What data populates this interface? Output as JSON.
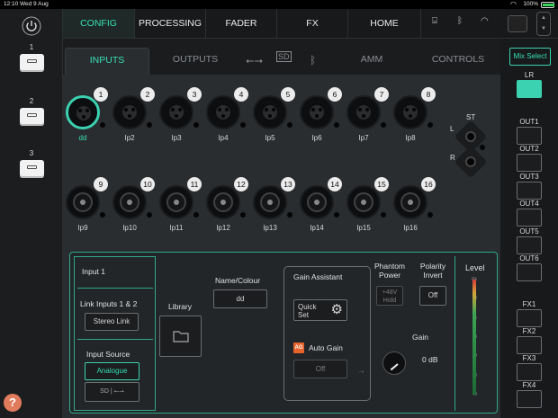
{
  "status": {
    "time": "12:10",
    "date": "Wed 9 Aug",
    "battery": "100%",
    "battery_level": 1.0
  },
  "scenes": [
    {
      "number": "1"
    },
    {
      "number": "2"
    },
    {
      "number": "3"
    }
  ],
  "help_label": "?",
  "top_tabs": [
    {
      "label": "CONFIG",
      "active": true
    },
    {
      "label": "PROCESSING",
      "active": false
    },
    {
      "label": "FADER",
      "active": false
    },
    {
      "label": "FX",
      "active": false
    },
    {
      "label": "HOME",
      "active": false
    }
  ],
  "sub_tabs": [
    {
      "label": "INPUTS",
      "active": true
    },
    {
      "label": "OUTPUTS",
      "active": false
    },
    {
      "label": "AMM",
      "active": false
    },
    {
      "label": "CONTROLS",
      "active": false
    }
  ],
  "inputs_row1": [
    {
      "num": "1",
      "label": "dd",
      "selected": true
    },
    {
      "num": "2",
      "label": "Ip2"
    },
    {
      "num": "3",
      "label": "Ip3"
    },
    {
      "num": "4",
      "label": "Ip4"
    },
    {
      "num": "5",
      "label": "Ip5"
    },
    {
      "num": "6",
      "label": "Ip6"
    },
    {
      "num": "7",
      "label": "Ip7"
    },
    {
      "num": "8",
      "label": "Ip8"
    }
  ],
  "inputs_row2": [
    {
      "num": "9",
      "label": "Ip9"
    },
    {
      "num": "10",
      "label": "Ip10"
    },
    {
      "num": "11",
      "label": "Ip11"
    },
    {
      "num": "12",
      "label": "Ip12"
    },
    {
      "num": "13",
      "label": "Ip13"
    },
    {
      "num": "14",
      "label": "Ip14"
    },
    {
      "num": "15",
      "label": "Ip15"
    },
    {
      "num": "16",
      "label": "Ip16"
    }
  ],
  "stereo": {
    "title": "ST",
    "left": "L",
    "right": "R"
  },
  "channel": {
    "name_header": "Input 1",
    "link_label": "Link Inputs 1 & 2",
    "stereo_link_btn": "Stereo Link",
    "input_source_label": "Input Source",
    "input_source_value": "Analogue",
    "library_label": "Library",
    "name_colour_label": "Name/Colour",
    "name_value": "dd",
    "gain_assistant_label": "Gain Assistant",
    "quick_set_label": "Quick Set",
    "ag_badge": "AG",
    "auto_gain_label": "Auto Gain",
    "auto_gain_value": "Off",
    "phantom_label": "Phantom Power",
    "phantom_btn": "+48V Hold",
    "polarity_label": "Polarity Invert",
    "polarity_btn": "Off",
    "gain_label": "Gain",
    "gain_value": "0 dB"
  },
  "meter": {
    "title": "Level",
    "scale": [
      "Pk",
      "0",
      "5",
      "10",
      "20",
      "30",
      "40"
    ]
  },
  "mix": {
    "select_label": "Mix Select",
    "buses": [
      {
        "label": "LR",
        "active": true
      },
      {
        "label": "OUT1"
      },
      {
        "label": "OUT2"
      },
      {
        "label": "OUT3"
      },
      {
        "label": "OUT4"
      },
      {
        "label": "OUT5"
      },
      {
        "label": "OUT6"
      },
      {
        "label": "FX1"
      },
      {
        "label": "FX2"
      },
      {
        "label": "FX3"
      },
      {
        "label": "FX4"
      }
    ]
  },
  "colors": {
    "accent": "#35e0b4",
    "panel_border": "#2fa88a",
    "ag_badge": "#e8622c"
  }
}
